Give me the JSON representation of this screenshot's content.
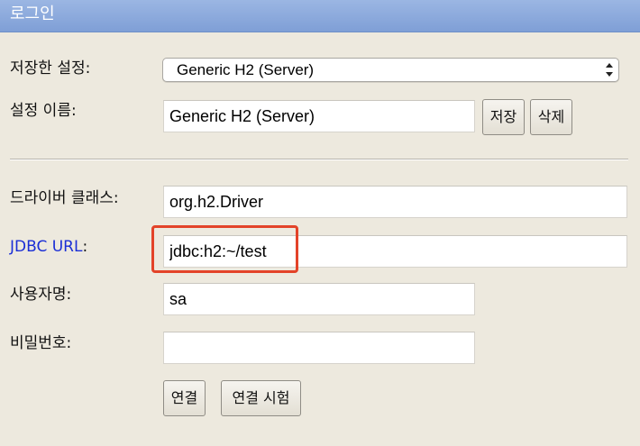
{
  "header": {
    "title": "로그인"
  },
  "form": {
    "saved_settings": {
      "label": "저장한 설정:",
      "selected": "Generic H2 (Server)"
    },
    "setting_name": {
      "label": "설정 이름:",
      "value": "Generic H2 (Server)",
      "save_label": "저장",
      "delete_label": "삭제"
    },
    "driver_class": {
      "label": "드라이버 클래스:",
      "value": "org.h2.Driver"
    },
    "jdbc_url": {
      "label": "JDBC URL",
      "colon": ":",
      "value": "jdbc:h2:~/test"
    },
    "username": {
      "label": "사용자명:",
      "value": "sa"
    },
    "password": {
      "label": "비밀번호:",
      "value": ""
    },
    "buttons": {
      "connect": "연결",
      "test_connection": "연결 시험"
    }
  },
  "annotation": {
    "highlight_color": "#e34329"
  }
}
